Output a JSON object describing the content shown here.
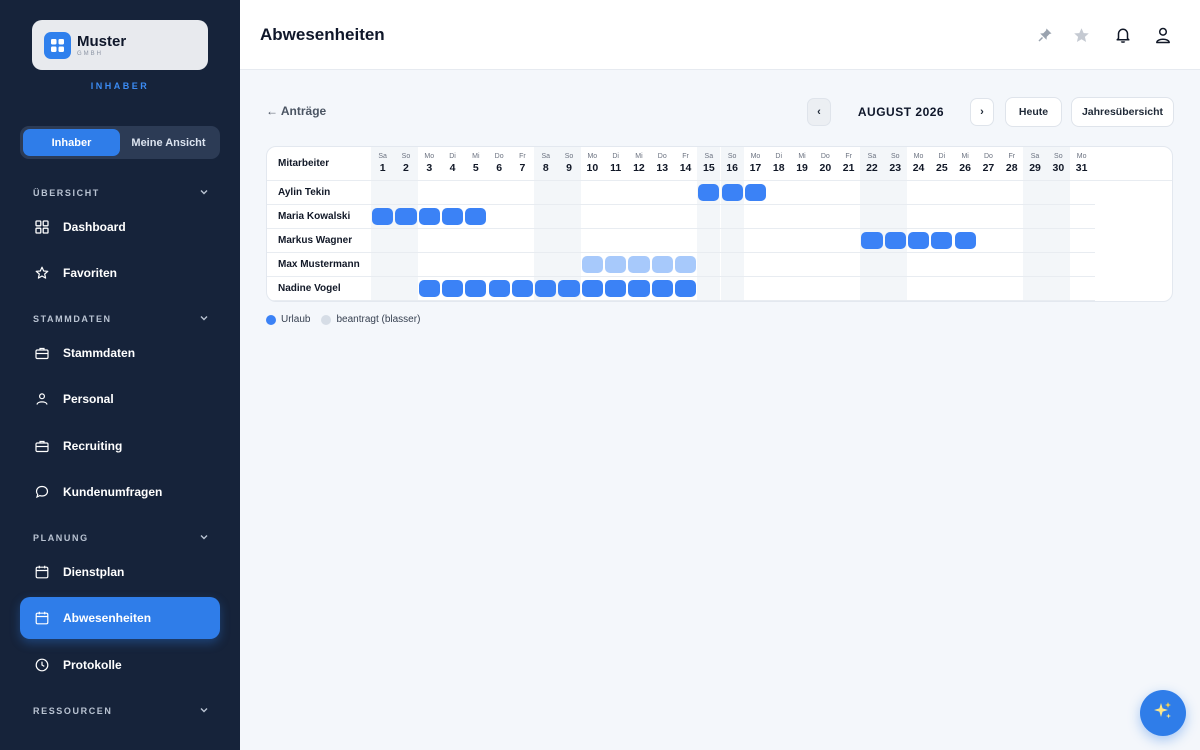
{
  "brand": {
    "name": "Muster",
    "sub": "GMBH",
    "role": "INHABER"
  },
  "toggle": {
    "left": "Inhaber",
    "right": "Meine Ansicht"
  },
  "sidebar": {
    "sections": [
      {
        "title": "ÜBERSICHT",
        "items": [
          "Dashboard",
          "Favoriten"
        ]
      },
      {
        "title": "STAMMDATEN",
        "items": [
          "Stammdaten",
          "Personal",
          "Recruiting",
          "Kundenumfragen"
        ]
      },
      {
        "title": "PLANUNG",
        "items": [
          "Dienstplan",
          "Abwesenheiten",
          "Protokolle"
        ]
      },
      {
        "title": "RESSOURCEN",
        "items": []
      }
    ],
    "active_item": "Abwesenheiten"
  },
  "header": {
    "title": "Abwesenheiten"
  },
  "toolbar": {
    "back": "← Anträge",
    "prev": "‹",
    "next": "›",
    "month": "AUGUST 2026",
    "today": "Heute",
    "year_view": "Jahresübersicht"
  },
  "calendar": {
    "employee_header": "Mitarbeiter",
    "days": [
      {
        "d": "1",
        "w": "Sa"
      },
      {
        "d": "2",
        "w": "So"
      },
      {
        "d": "3",
        "w": "Mo"
      },
      {
        "d": "4",
        "w": "Di"
      },
      {
        "d": "5",
        "w": "Mi"
      },
      {
        "d": "6",
        "w": "Do"
      },
      {
        "d": "7",
        "w": "Fr"
      },
      {
        "d": "8",
        "w": "Sa"
      },
      {
        "d": "9",
        "w": "So"
      },
      {
        "d": "10",
        "w": "Mo"
      },
      {
        "d": "11",
        "w": "Di"
      },
      {
        "d": "12",
        "w": "Mi"
      },
      {
        "d": "13",
        "w": "Do"
      },
      {
        "d": "14",
        "w": "Fr"
      },
      {
        "d": "15",
        "w": "Sa"
      },
      {
        "d": "16",
        "w": "So"
      },
      {
        "d": "17",
        "w": "Mo"
      },
      {
        "d": "18",
        "w": "Di"
      },
      {
        "d": "19",
        "w": "Mi"
      },
      {
        "d": "20",
        "w": "Do"
      },
      {
        "d": "21",
        "w": "Fr"
      },
      {
        "d": "22",
        "w": "Sa"
      },
      {
        "d": "23",
        "w": "So"
      },
      {
        "d": "24",
        "w": "Mo"
      },
      {
        "d": "25",
        "w": "Di"
      },
      {
        "d": "26",
        "w": "Mi"
      },
      {
        "d": "27",
        "w": "Do"
      },
      {
        "d": "28",
        "w": "Fr"
      },
      {
        "d": "29",
        "w": "Sa"
      },
      {
        "d": "30",
        "w": "So"
      },
      {
        "d": "31",
        "w": "Mo"
      }
    ],
    "employees": [
      {
        "name": "Aylin Tekin",
        "absences": [
          {
            "from": 15,
            "to": 17,
            "status": "approved"
          }
        ]
      },
      {
        "name": "Maria Kowalski",
        "absences": [
          {
            "from": 1,
            "to": 5,
            "status": "approved"
          }
        ]
      },
      {
        "name": "Markus Wagner",
        "absences": [
          {
            "from": 22,
            "to": 26,
            "status": "approved"
          }
        ]
      },
      {
        "name": "Max Mustermann",
        "absences": [
          {
            "from": 10,
            "to": 14,
            "status": "pending"
          }
        ]
      },
      {
        "name": "Nadine Vogel",
        "absences": [
          {
            "from": 3,
            "to": 14,
            "status": "approved"
          }
        ]
      }
    ]
  },
  "legend": [
    {
      "label": "Urlaub",
      "color": "#3b82f6"
    },
    {
      "label": "beantragt (blasser)",
      "color": "#d6dde6"
    }
  ],
  "colors": {
    "accent": "#2f7de9",
    "sidebar": "#16233a",
    "approved": "#3b82f6",
    "pending": "#a7c9fb"
  }
}
